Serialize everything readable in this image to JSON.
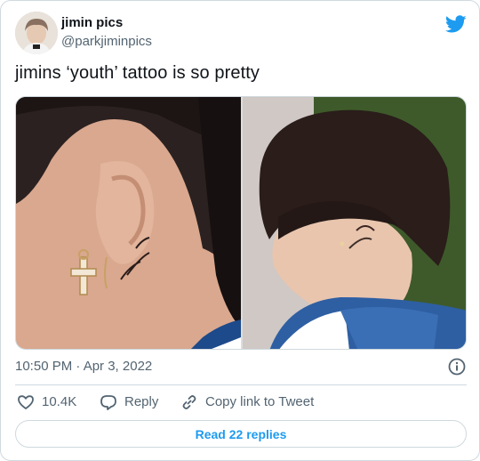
{
  "author": {
    "display_name": "jimin pics",
    "handle": "@parkjiminpics",
    "avatar": "avatar-photo"
  },
  "brand": {
    "logo_icon": "twitter-bird-icon",
    "color": "#1d9bf0"
  },
  "tweet": {
    "text": "jimins ‘youth’ tattoo is so pretty",
    "timestamp": "10:50 PM · Apr 3, 2022",
    "media": [
      {
        "kind": "photo",
        "subject": "ear-with-cross-earring-and-youth-tattoo"
      },
      {
        "kind": "photo",
        "subject": "profile-in-blue-jacket"
      }
    ]
  },
  "actions": {
    "like": {
      "icon": "heart-icon",
      "count": "10.4K"
    },
    "reply": {
      "icon": "reply-bubble-icon",
      "label": "Reply"
    },
    "copy_link": {
      "icon": "link-icon",
      "label": "Copy link to Tweet"
    }
  },
  "footer": {
    "read_replies_label": "Read 22 replies"
  },
  "colors": {
    "text": "#0f1419",
    "secondary": "#536471",
    "border": "#cfd9de",
    "accent": "#1d9bf0"
  }
}
